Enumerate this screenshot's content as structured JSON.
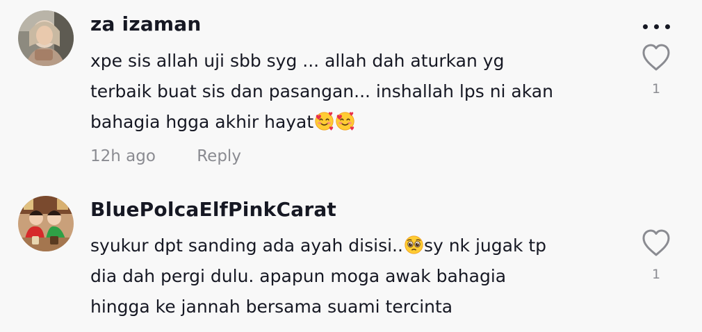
{
  "comments": [
    {
      "username": "za izaman",
      "lines": [
        "xpe sis allah uji sbb syg ... allah dah aturkan yg",
        "terbaik buat sis dan pasangan... inshallah lps ni akan",
        "bahagia hgga akhir hayat"
      ],
      "emoji": [
        "smiling-face-with-hearts",
        "smiling-face-with-hearts"
      ],
      "time": "12h ago",
      "reply_label": "Reply",
      "likes": "1"
    },
    {
      "username": "BluePolcaElfPinkCarat",
      "line1_before": "syukur dpt sanding ada ayah disisi..",
      "line1_emoji": "pleading-face",
      "line1_after": "sy nk jugak tp",
      "lines_rest": [
        "dia dah pergi dulu. apapun moga awak bahagia",
        "hingga ke jannah bersama suami tercinta"
      ],
      "likes": "1"
    }
  ],
  "colors": {
    "background": "#f8f8f8",
    "text": "#161823",
    "muted": "#8a8b91"
  },
  "icons": {
    "more": "more-horizontal-icon",
    "like": "heart-outline-icon"
  }
}
